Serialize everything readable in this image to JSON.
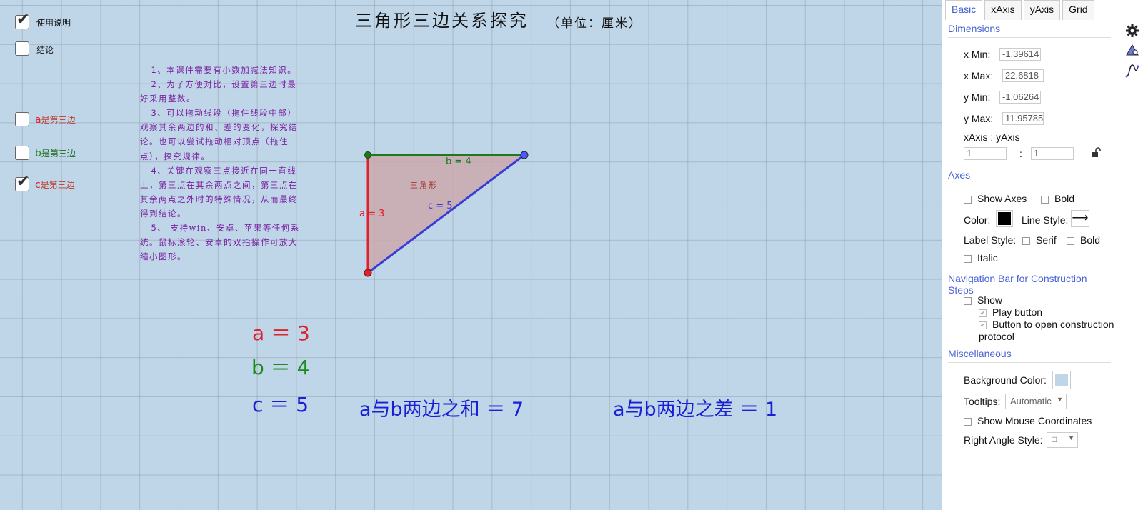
{
  "title": "三角形三边关系探究",
  "unit": "（单位：厘米）",
  "checkboxes": {
    "instructions": {
      "label": "使用说明",
      "checked": true
    },
    "conclusion": {
      "label": "结论",
      "checked": false
    },
    "a_third": {
      "prefix": "a",
      "suffix": "是第三边",
      "checked": false
    },
    "b_third": {
      "prefix": "b",
      "suffix": "是第三边",
      "checked": false
    },
    "c_third": {
      "prefix": "c",
      "suffix": "是第三边",
      "checked": true
    }
  },
  "instructions": [
    {
      "num": "1",
      "text": "、本课件需要有小数加减法知识。"
    },
    {
      "num": "2",
      "text": "、为了方便对比，设置第三边时最好采用整数。"
    },
    {
      "num": "3",
      "text": "、可以拖动线段（拖住线段中部）观察其余两边的和、差的变化，探究结论。也可以尝试拖动相对顶点（拖住点），探究规律。"
    },
    {
      "num": "4",
      "text": "、关键在观察三点接近在同一直线上，第三点在其余两点之间，第三点在其余两点之外时的特殊情况，从而最终得到结论。"
    },
    {
      "num": "5",
      "text": "、 支持win、安卓、苹果等任何系统。鼠标滚轮、安卓的双指操作可放大缩小图形。"
    }
  ],
  "triangle": {
    "label_a": "a = 3",
    "label_b": "b = 4",
    "label_c": "c = 5",
    "name": "三角形"
  },
  "values": {
    "a": "a ＝ 3",
    "b": "b ＝ 4",
    "c": "c ＝ 5",
    "sum": "a与b两边之和 ＝ 7",
    "diff": "a与b两边之差 ＝ 1"
  },
  "colors": {
    "a": "#e0202a",
    "b": "#1c8a1c",
    "c": "#3b3bd6",
    "background": "#bfd5e8",
    "fill": "#c9a9ad",
    "instructions": "#7a1fa0",
    "accent": "#4a63d6"
  },
  "panel": {
    "tabs": [
      "Basic",
      "xAxis",
      "yAxis",
      "Grid"
    ],
    "sections": {
      "dimensions": "Dimensions",
      "axes": "Axes",
      "navbar": "Navigation Bar for Construction Steps",
      "misc": "Miscellaneous"
    },
    "xmin_label": "x Min:",
    "xmin": "-1.39614",
    "xmax_label": "x Max:",
    "xmax": "22.6818",
    "ymin_label": "y Min:",
    "ymin": "-1.06264",
    "ymax_label": "y Max:",
    "ymax": "11.95785",
    "ratio_label": "xAxis : yAxis",
    "ratio_x": "1",
    "ratio_sep": ":",
    "ratio_y": "1",
    "show_axes": "Show Axes",
    "bold": "Bold",
    "color_label": "Color:",
    "line_style_label": "Line Style:",
    "line_style_icon": "⟶",
    "label_style": "Label Style:",
    "serif": "Serif",
    "bold2": "Bold",
    "italic": "Italic",
    "show": "Show",
    "play_button": "Play button",
    "open_protocol": "Button to open construction",
    "protocol": "protocol",
    "bg_color_label": "Background Color:",
    "tooltips_label": "Tooltips:",
    "tooltips_value": "Automatic",
    "show_mouse": "Show Mouse Coordinates",
    "right_angle_label": "Right Angle Style:",
    "right_angle_value": "□"
  },
  "side_icons": [
    "gear-icon",
    "graphics-icon",
    "algebra-curve-icon"
  ]
}
